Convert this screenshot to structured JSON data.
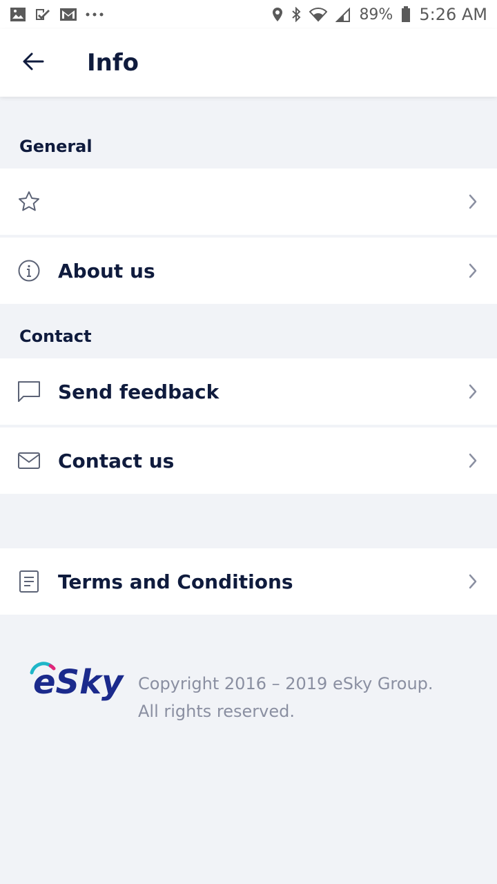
{
  "status_bar": {
    "battery": "89%",
    "time": "5:26 AM",
    "left_icons": [
      "gallery-icon",
      "check-icon",
      "gmail-icon",
      "more-dots-icon"
    ],
    "right_icons": [
      "location-icon",
      "bluetooth-icon",
      "wifi-icon",
      "signal-icon",
      "battery-icon"
    ]
  },
  "header": {
    "back_icon": "arrow-left-icon",
    "title": "Info"
  },
  "sections": {
    "general": {
      "label": "General",
      "items": [
        {
          "label": "",
          "icon": "star-icon"
        },
        {
          "label": "About us",
          "icon": "info-icon"
        }
      ]
    },
    "contact": {
      "label": "Contact",
      "items": [
        {
          "label": "Send feedback",
          "icon": "chat-bubble-icon"
        },
        {
          "label": "Contact us",
          "icon": "envelope-icon"
        }
      ]
    },
    "legal": {
      "items": [
        {
          "label": "Terms and Conditions",
          "icon": "document-icon"
        }
      ]
    }
  },
  "footer": {
    "logo_text": "eSky",
    "copyright_line1": "Copyright 2016 – 2019 eSky Group.",
    "copyright_line2": "All rights reserved."
  },
  "colors": {
    "primary_text": "#0f1b3d",
    "background": "#f1f3f7",
    "card": "#ffffff",
    "muted_text": "#8a8fa1",
    "logo_blue": "#1b2a8c",
    "logo_teal": "#1fb6c8",
    "logo_pink": "#e2267a"
  }
}
